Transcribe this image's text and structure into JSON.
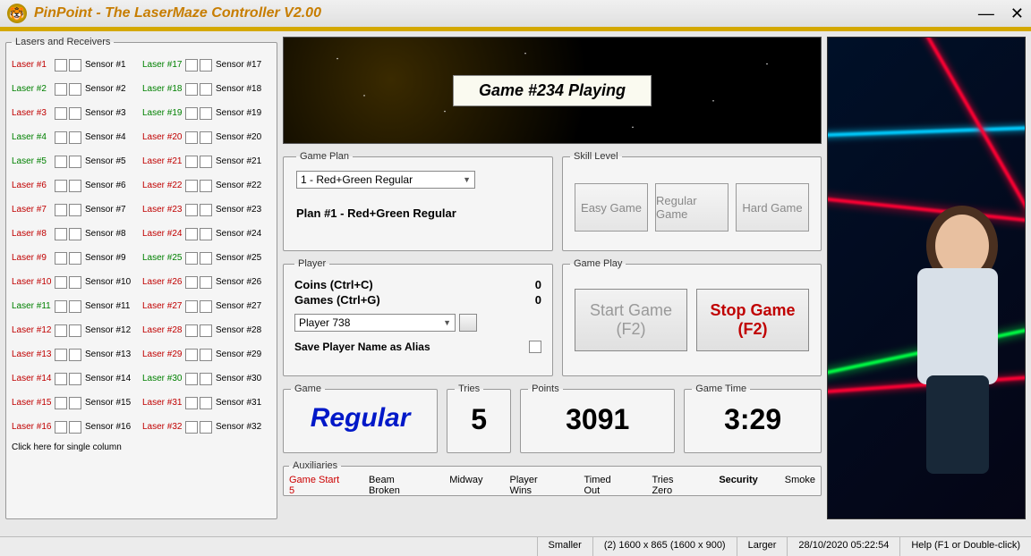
{
  "title": "PinPoint - The LaserMaze Controller V2.00",
  "lasers_receivers": {
    "legend": "Lasers and Receivers",
    "single_column_hint": "Click here for single column",
    "col1": [
      {
        "laser": "Laser #1",
        "sensor": "Sensor #1",
        "color": "red"
      },
      {
        "laser": "Laser #2",
        "sensor": "Sensor #2",
        "color": "green"
      },
      {
        "laser": "Laser #3",
        "sensor": "Sensor #3",
        "color": "red"
      },
      {
        "laser": "Laser #4",
        "sensor": "Sensor #4",
        "color": "green"
      },
      {
        "laser": "Laser #5",
        "sensor": "Sensor #5",
        "color": "green"
      },
      {
        "laser": "Laser #6",
        "sensor": "Sensor #6",
        "color": "red"
      },
      {
        "laser": "Laser #7",
        "sensor": "Sensor #7",
        "color": "red"
      },
      {
        "laser": "Laser #8",
        "sensor": "Sensor #8",
        "color": "red"
      },
      {
        "laser": "Laser #9",
        "sensor": "Sensor #9",
        "color": "red"
      },
      {
        "laser": "Laser #10",
        "sensor": "Sensor #10",
        "color": "red"
      },
      {
        "laser": "Laser #11",
        "sensor": "Sensor #11",
        "color": "green"
      },
      {
        "laser": "Laser #12",
        "sensor": "Sensor #12",
        "color": "red"
      },
      {
        "laser": "Laser #13",
        "sensor": "Sensor #13",
        "color": "red"
      },
      {
        "laser": "Laser #14",
        "sensor": "Sensor #14",
        "color": "red"
      },
      {
        "laser": "Laser #15",
        "sensor": "Sensor #15",
        "color": "red"
      },
      {
        "laser": "Laser #16",
        "sensor": "Sensor #16",
        "color": "red"
      }
    ],
    "col2": [
      {
        "laser": "Laser #17",
        "sensor": "Sensor #17",
        "color": "green"
      },
      {
        "laser": "Laser #18",
        "sensor": "Sensor #18",
        "color": "green"
      },
      {
        "laser": "Laser #19",
        "sensor": "Sensor #19",
        "color": "green"
      },
      {
        "laser": "Laser #20",
        "sensor": "Sensor #20",
        "color": "red"
      },
      {
        "laser": "Laser #21",
        "sensor": "Sensor #21",
        "color": "red"
      },
      {
        "laser": "Laser #22",
        "sensor": "Sensor #22",
        "color": "red"
      },
      {
        "laser": "Laser #23",
        "sensor": "Sensor #23",
        "color": "red"
      },
      {
        "laser": "Laser #24",
        "sensor": "Sensor #24",
        "color": "red"
      },
      {
        "laser": "Laser #25",
        "sensor": "Sensor #25",
        "color": "green"
      },
      {
        "laser": "Laser #26",
        "sensor": "Sensor #26",
        "color": "red"
      },
      {
        "laser": "Laser #27",
        "sensor": "Sensor #27",
        "color": "red"
      },
      {
        "laser": "Laser #28",
        "sensor": "Sensor #28",
        "color": "red"
      },
      {
        "laser": "Laser #29",
        "sensor": "Sensor #29",
        "color": "red"
      },
      {
        "laser": "Laser #30",
        "sensor": "Sensor #30",
        "color": "green"
      },
      {
        "laser": "Laser #31",
        "sensor": "Sensor #31",
        "color": "red"
      },
      {
        "laser": "Laser #32",
        "sensor": "Sensor #32",
        "color": "red"
      }
    ]
  },
  "banner": {
    "status": "Game #234 Playing"
  },
  "gameplan": {
    "legend": "Game Plan",
    "selected": "1 - Red+Green Regular",
    "desc": "Plan #1 - Red+Green Regular"
  },
  "skill": {
    "legend": "Skill Level",
    "easy": "Easy Game",
    "regular": "Regular Game",
    "hard": "Hard Game"
  },
  "player": {
    "legend": "Player",
    "coins_label": "Coins (Ctrl+C)",
    "coins_value": "0",
    "games_label": "Games (Ctrl+G)",
    "games_value": "0",
    "selected": "Player 738",
    "save_alias_label": "Save Player Name as Alias"
  },
  "gameplay": {
    "legend": "Game Play",
    "start_label": "Start Game",
    "start_sub": "(F2)",
    "stop_label": "Stop Game",
    "stop_sub": "(F2)"
  },
  "stats": {
    "game_legend": "Game",
    "game_value": "Regular",
    "tries_legend": "Tries",
    "tries_value": "5",
    "points_legend": "Points",
    "points_value": "3091",
    "time_legend": "Game Time",
    "time_value": "3:29"
  },
  "aux": {
    "legend": "Auxiliaries",
    "items": [
      "Game Start 5",
      "Beam Broken",
      "Midway",
      "Player Wins",
      "Timed Out",
      "Tries Zero",
      "Security",
      "Smoke"
    ]
  },
  "statusbar": {
    "smaller": "Smaller",
    "size": "(2)  1600 x 865 (1600 x 900)",
    "larger": "Larger",
    "datetime": "28/10/2020  05:22:54",
    "help": "Help (F1 or Double-click)"
  }
}
